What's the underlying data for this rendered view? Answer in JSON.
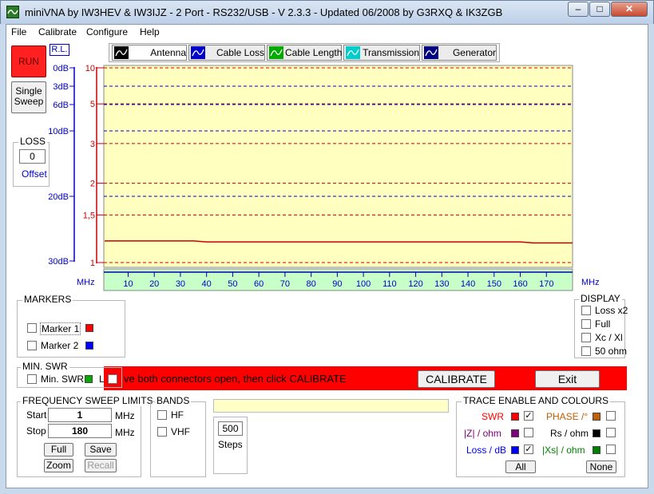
{
  "window": {
    "title": "miniVNA by IW3HEV & IW3IJZ - 2 Port - RS232/USB - V 2.3.3 - Updated 06/2008 by G3RXQ & IK3ZGB",
    "minimize": "–",
    "maximize": "□",
    "close": "✕"
  },
  "menu": [
    "File",
    "Calibrate",
    "Configure",
    "Help"
  ],
  "left": {
    "run": "RUN",
    "single_sweep_1": "Single",
    "single_sweep_2": "Sweep",
    "rl_label": "R.L.",
    "loss_legend": "LOSS",
    "loss_value": "0",
    "offset_label": "Offset"
  },
  "tabs": [
    {
      "label": "Antenna",
      "icon": "antenna-icon"
    },
    {
      "label": "Cable Loss",
      "icon": "cable-loss-icon"
    },
    {
      "label": "Cable Length",
      "icon": "cable-length-icon"
    },
    {
      "label": "Transmission",
      "icon": "transmission-icon"
    },
    {
      "label": "Generator",
      "icon": "generator-icon"
    }
  ],
  "chart_data": {
    "type": "line",
    "x_unit": "MHz",
    "xlim": [
      1,
      180
    ],
    "x_ticks": [
      10,
      20,
      30,
      40,
      50,
      60,
      70,
      80,
      90,
      100,
      110,
      120,
      130,
      140,
      150,
      160,
      170
    ],
    "rl_ticks": [
      "0dB",
      "3dB",
      "6dB",
      "10dB",
      "20dB",
      "30dB"
    ],
    "swr_ticks": [
      "10",
      "5",
      "3",
      "2",
      "1,5",
      "1"
    ],
    "series": [
      {
        "x": [
          1,
          35,
          40,
          160,
          165,
          180
        ],
        "swr": [
          1.2,
          1.2,
          1.19,
          1.19,
          1.18,
          1.18
        ],
        "color": "#cc0000"
      }
    ],
    "colors": {
      "plot_bg": "#ffffc0",
      "xaxis_bg": "#c8ffc8",
      "swr": "#cc0000",
      "rl": "#0000cc"
    }
  },
  "markers": {
    "legend": "MARKERS",
    "marker1": "Marker 1",
    "marker2": "Marker 2",
    "marker1_color": "#ff0000",
    "marker2_color": "#0000ff"
  },
  "display": {
    "legend": "DISPLAY",
    "items": [
      "Loss x2",
      "Full",
      "Xc / Xl",
      "50 ohm"
    ]
  },
  "minswr": {
    "legend": "MIN. SWR",
    "label": "Min. SWR",
    "l_label": "L",
    "color": "#00aa00"
  },
  "status": {
    "message": "ve both connectors open, then click CALIBRATE",
    "calibrate": "CALIBRATE",
    "exit": "Exit"
  },
  "sweep": {
    "legend": "FREQUENCY SWEEP LIMITS",
    "start_label": "Start",
    "start_value": "1",
    "stop_label": "Stop",
    "stop_value": "180",
    "unit": "MHz",
    "full": "Full",
    "save": "Save",
    "zoom": "Zoom",
    "recall": "Recall"
  },
  "bands": {
    "legend": "BANDS",
    "hf": "HF",
    "vhf": "VHF"
  },
  "steps": {
    "value": "500",
    "label": "Steps"
  },
  "trace": {
    "legend": "TRACE ENABLE AND COLOURS",
    "swr": "SWR",
    "z": "|Z| / ohm",
    "loss": "Loss / dB",
    "phase": "PHASE /°",
    "rs": "Rs / ohm",
    "xs": "|Xs| / ohm",
    "all": "All",
    "none": "None",
    "swr_color": "#ff0000",
    "z_color": "#800080",
    "loss_color": "#0000ff",
    "phase_color": "#c06000",
    "rs_color": "#000000",
    "xs_color": "#008000"
  }
}
